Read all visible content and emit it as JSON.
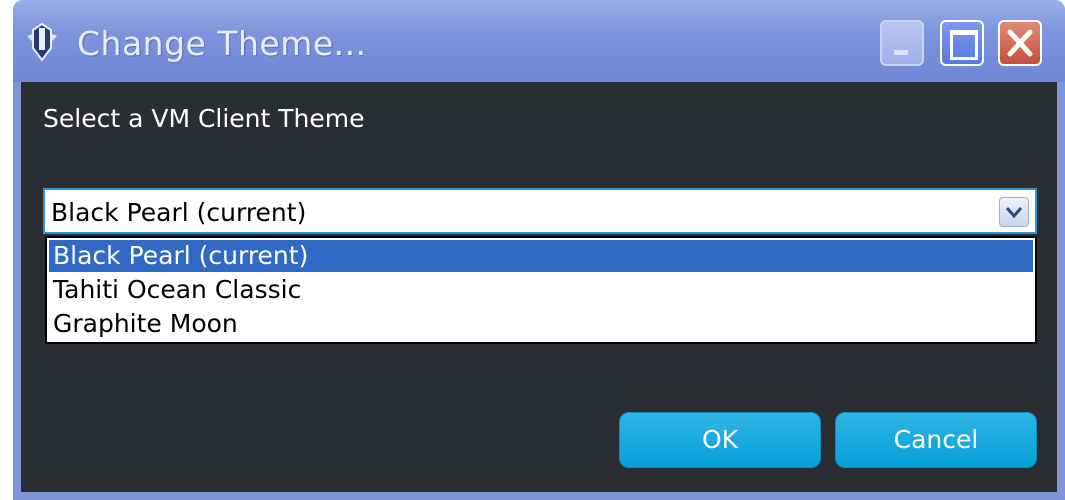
{
  "window": {
    "title": "Change Theme...",
    "controls": {
      "minimize": "minimize",
      "maximize": "maximize",
      "close": "close"
    }
  },
  "dialog": {
    "prompt": "Select a VM Client Theme",
    "combo": {
      "selected_value": "Black Pearl (current)",
      "options": [
        {
          "label": "Black Pearl (current)",
          "highlighted": true
        },
        {
          "label": "Tahiti Ocean Classic",
          "highlighted": false
        },
        {
          "label": "Graphite Moon",
          "highlighted": false
        }
      ]
    },
    "buttons": {
      "ok": "OK",
      "cancel": "Cancel"
    }
  },
  "icons": {
    "app": "vm-client-icon",
    "dropdown": "chevron-down-icon"
  },
  "colors": {
    "title_bar": "#7d94dd",
    "client_background": "#2a2d31",
    "selection": "#3169c6",
    "button": "#05a0d9",
    "close_button": "#c6503b"
  }
}
